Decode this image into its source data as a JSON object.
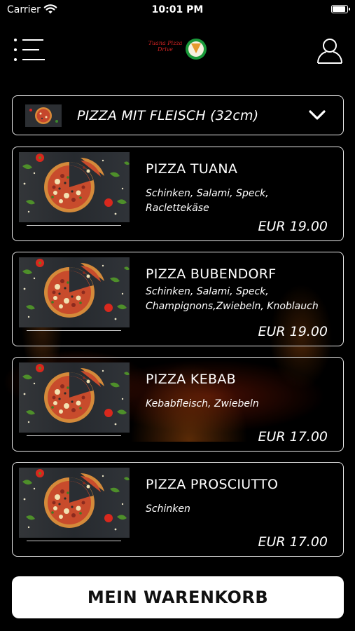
{
  "status_bar": {
    "carrier": "Carrier",
    "time": "10:01 PM"
  },
  "header": {
    "logo_text": "Tuana Pizza Drive"
  },
  "category": {
    "label": "PIZZA MIT FLEISCH (32cm)"
  },
  "products": [
    {
      "name": "PIZZA TUANA",
      "description": "Schinken, Salami, Speck, Raclettekäse",
      "price": "EUR 19.00"
    },
    {
      "name": "PIZZA BUBENDORF",
      "description": "Schinken, Salami, Speck, Champignons,Zwiebeln, Knoblauch",
      "price": "EUR 19.00"
    },
    {
      "name": "PIZZA KEBAB",
      "description": "Kebabfleisch, Zwiebeln",
      "price": "EUR 17.00"
    },
    {
      "name": "PIZZA PROSCIUTTO",
      "description": "Schinken",
      "price": "EUR 17.00"
    }
  ],
  "cart": {
    "label": "MEIN WARENKORB"
  },
  "icons": {
    "menu": "menu-list-icon",
    "user": "user-icon",
    "chevron": "chevron-down-icon",
    "wifi": "wifi-icon",
    "battery": "battery-icon"
  },
  "colors": {
    "background": "#000000",
    "card_border": "#e9e9e9",
    "button_bg": "#ffffff",
    "button_text": "#111111",
    "logo_green": "#1a9a3a",
    "logo_red": "#cc2222"
  }
}
